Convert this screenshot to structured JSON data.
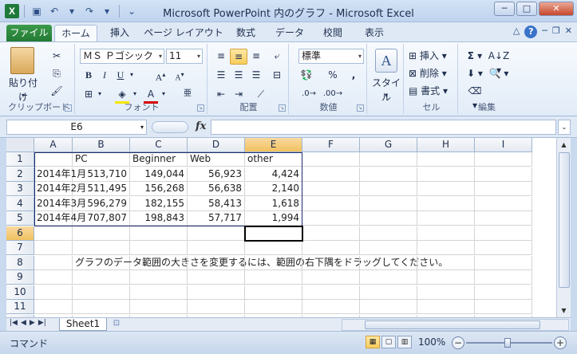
{
  "window": {
    "title": "Microsoft PowerPoint 内のグラフ - Microsoft Excel",
    "quick_access": {
      "dropdown_marker": "▾"
    }
  },
  "tabs": [
    {
      "label": "ファイル"
    },
    {
      "label": "ホーム"
    },
    {
      "label": "挿入"
    },
    {
      "label": "ページ レイアウト"
    },
    {
      "label": "数式"
    },
    {
      "label": "データ"
    },
    {
      "label": "校閲"
    },
    {
      "label": "表示"
    }
  ],
  "ribbon": {
    "clipboard": {
      "paste_label": "貼り付け",
      "group_label": "クリップボード"
    },
    "font": {
      "font_name": "ＭＳ Ｐゴシック",
      "font_size": "11",
      "bold": "B",
      "italic": "I",
      "underline": "U",
      "grow": "A",
      "shrink": "A",
      "group_label": "フォント"
    },
    "alignment": {
      "group_label": "配置"
    },
    "number": {
      "format": "標準",
      "group_label": "数値"
    },
    "styles": {
      "label": "スタイル"
    },
    "cells": {
      "insert": "挿入",
      "delete": "削除",
      "format": "書式",
      "group_label": "セル"
    },
    "editing": {
      "group_label": "編集"
    }
  },
  "formula_bar": {
    "name_box": "E6",
    "fx": "fx",
    "value": ""
  },
  "sheet": {
    "columns": [
      "A",
      "B",
      "C",
      "D",
      "E",
      "F",
      "G",
      "H",
      "I"
    ],
    "rows": [
      "1",
      "2",
      "3",
      "4",
      "5",
      "6",
      "7",
      "8",
      "9",
      "10",
      "11",
      "12"
    ],
    "header": [
      "",
      "PC",
      "Beginner",
      "Web",
      "other"
    ],
    "data": [
      [
        "2014年1月",
        "513,710",
        "149,044",
        "56,923",
        "4,424"
      ],
      [
        "2014年2月",
        "511,495",
        "156,268",
        "56,638",
        "2,140"
      ],
      [
        "2014年3月",
        "596,279",
        "182,155",
        "58,413",
        "1,618"
      ],
      [
        "2014年4月",
        "707,807",
        "198,843",
        "57,717",
        "1,994"
      ]
    ],
    "note": "グラフのデータ範囲の大きさを変更するには、範囲の右下隅をドラッグしてください。",
    "tab_name": "Sheet1"
  },
  "status": {
    "mode": "コマンド",
    "zoom": "100%"
  }
}
